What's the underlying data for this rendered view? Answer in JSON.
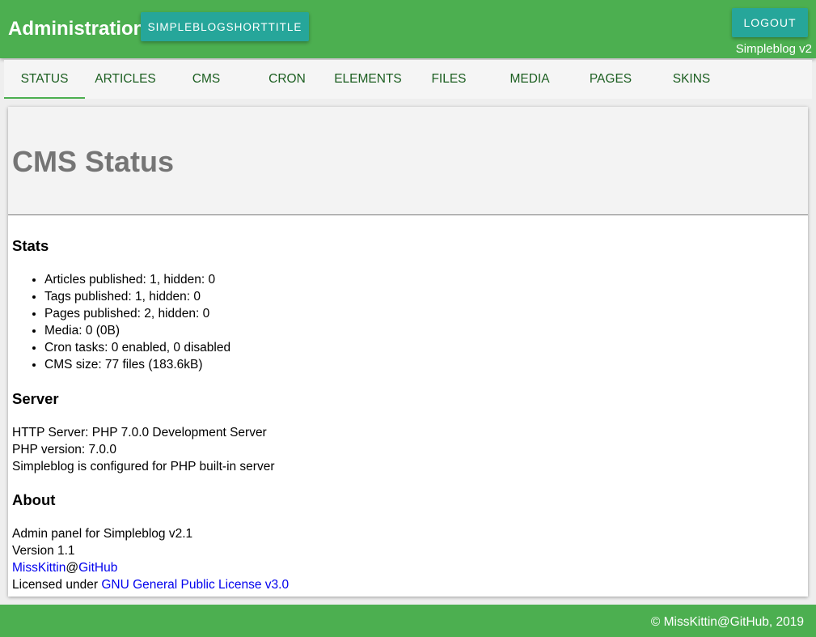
{
  "header": {
    "title": "Administration",
    "site_button": "SIMPLEBLOGSHORTTITLE",
    "logout_button": "LOGOUT",
    "version": "Simpleblog v2"
  },
  "tabs": [
    {
      "label": "STATUS",
      "active": true
    },
    {
      "label": "ARTICLES",
      "active": false
    },
    {
      "label": "CMS",
      "active": false
    },
    {
      "label": "CRON",
      "active": false
    },
    {
      "label": "ELEMENTS",
      "active": false
    },
    {
      "label": "FILES",
      "active": false
    },
    {
      "label": "MEDIA",
      "active": false
    },
    {
      "label": "PAGES",
      "active": false
    },
    {
      "label": "SKINS",
      "active": false
    }
  ],
  "main": {
    "page_title": "CMS Status",
    "stats": {
      "title": "Stats",
      "items": [
        "Articles published: 1, hidden: 0",
        "Tags published: 1, hidden: 0",
        "Pages published: 2, hidden: 0",
        "Media: 0 (0B)",
        "Cron tasks: 0 enabled, 0 disabled",
        "CMS size: 77 files (183.6kB)"
      ]
    },
    "server": {
      "title": "Server",
      "lines": [
        "HTTP Server: PHP 7.0.0 Development Server",
        "PHP version: 7.0.0",
        "Simpleblog is configured for PHP built-in server"
      ]
    },
    "about": {
      "title": "About",
      "admin_panel": "Admin panel for Simpleblog v2.1",
      "version": "Version 1.1",
      "author_link": "MissKittin",
      "at_sign": "@",
      "github_link": "GitHub",
      "license_prefix": "Licensed under ",
      "license_link": "GNU General Public License v3.0"
    }
  },
  "footer": {
    "copyright": "© MissKittin@GitHub, 2019"
  },
  "colors": {
    "primary": "#4caf50",
    "button": "#26a69a",
    "tab_text": "#1b5e20",
    "link": "#0000ee"
  }
}
